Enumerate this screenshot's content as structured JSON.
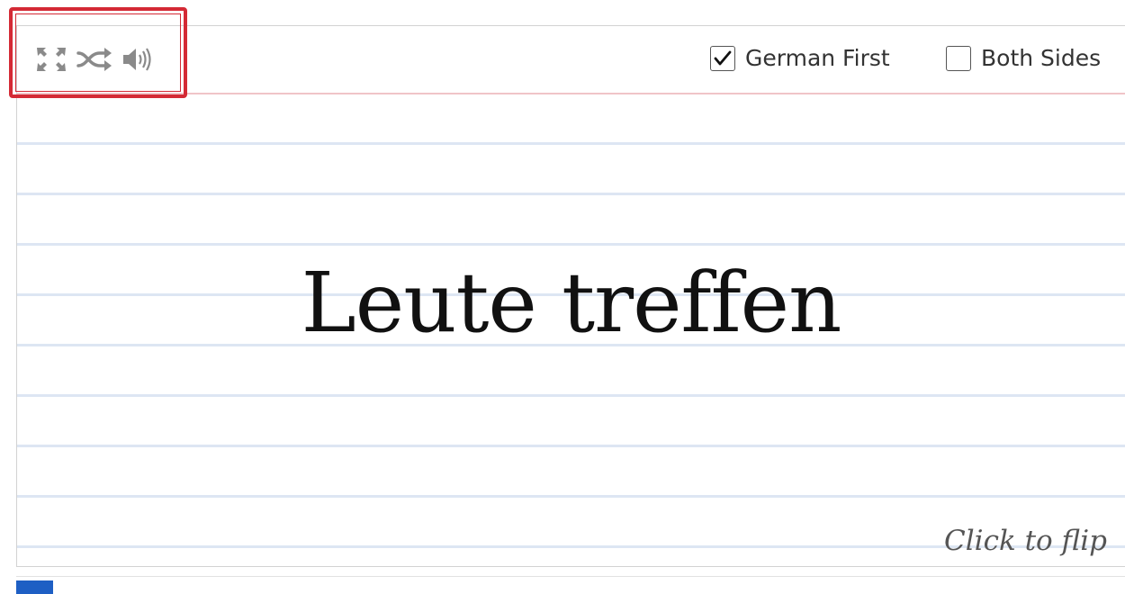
{
  "toolbar": {
    "icons": [
      "fullscreen-icon",
      "shuffle-icon",
      "speaker-icon"
    ],
    "options": {
      "german_first": {
        "label": "German First",
        "checked": true
      },
      "both_sides": {
        "label": "Both Sides",
        "checked": false
      }
    }
  },
  "card": {
    "term": "Leute treffen",
    "hint": "Click to flip"
  },
  "progress": {
    "fraction": 0.033
  },
  "colors": {
    "highlight": "#d42a35",
    "progress": "#1e5fc4",
    "rule_line": "#dde6f3",
    "toolbar_divider": "#f0c4c8"
  }
}
